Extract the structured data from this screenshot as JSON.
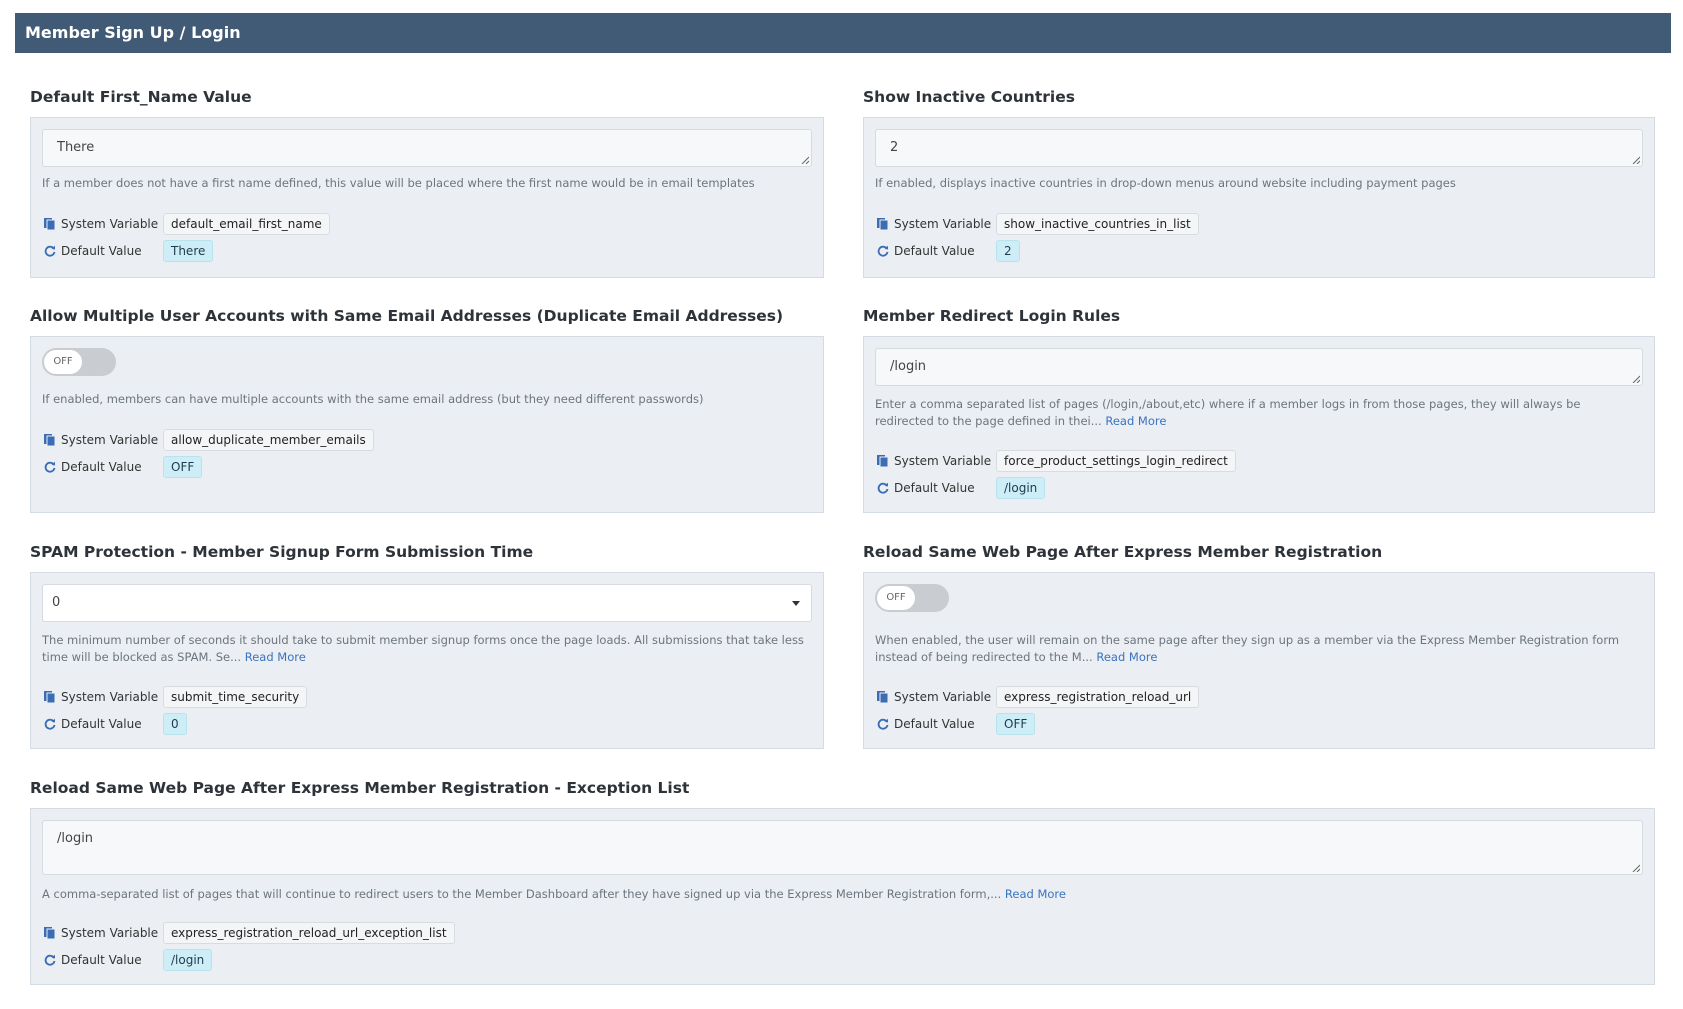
{
  "header": {
    "title": "Member Sign Up / Login"
  },
  "labels": {
    "system_variable": "System Variable",
    "default_value": "Default Value",
    "read_more": "Read More"
  },
  "settings": [
    {
      "title": "Default First_Name Value",
      "value": "There",
      "description": "If a member does not have a first name defined, this value will be placed where the first name would be in email templates",
      "system_variable": "default_email_first_name",
      "default_value": "There"
    },
    {
      "title": "Show Inactive Countries",
      "value": "2",
      "description": "If enabled, displays inactive countries in drop-down menus around website including payment pages",
      "system_variable": "show_inactive_countries_in_list",
      "default_value": "2"
    },
    {
      "title": "Allow Multiple User Accounts with Same Email Addresses (Duplicate Email Addresses)",
      "toggle": "OFF",
      "description": "If enabled, members can have multiple accounts with the same email address (but they need different passwords)",
      "system_variable": "allow_duplicate_member_emails",
      "default_value": "OFF"
    },
    {
      "title": "Member Redirect Login Rules",
      "value": "/login",
      "description": "Enter a comma separated list of pages (/login,/about,etc) where if a member logs in from those pages, they will always be redirected to the page defined in thei...",
      "system_variable": "force_product_settings_login_redirect",
      "default_value": "/login"
    },
    {
      "title": "SPAM Protection - Member Signup Form Submission Time",
      "value": "0",
      "description": "The minimum number of seconds it should take to submit member signup forms once the page loads.  All submissions that take less time will be blocked as SPAM. Se...",
      "system_variable": "submit_time_security",
      "default_value": "0"
    },
    {
      "title": "Reload Same Web Page After Express Member Registration",
      "toggle": "OFF",
      "description": "When enabled, the user will remain on the same page after they sign up as a member via the Express Member Registration form instead of being redirected to the M...",
      "system_variable": "express_registration_reload_url",
      "default_value": "OFF"
    },
    {
      "title": "Reload Same Web Page After Express Member Registration - Exception List",
      "value": "/login",
      "description": "A comma-separated list of pages that will continue to redirect users to the Member Dashboard after they have signed up via the Express Member Registration form,...",
      "system_variable": "express_registration_reload_url_exception_list",
      "default_value": "/login"
    }
  ],
  "icons": {
    "system_variable": "copy-icon",
    "default_value": "refresh-icon",
    "select": "caret-down-icon"
  }
}
